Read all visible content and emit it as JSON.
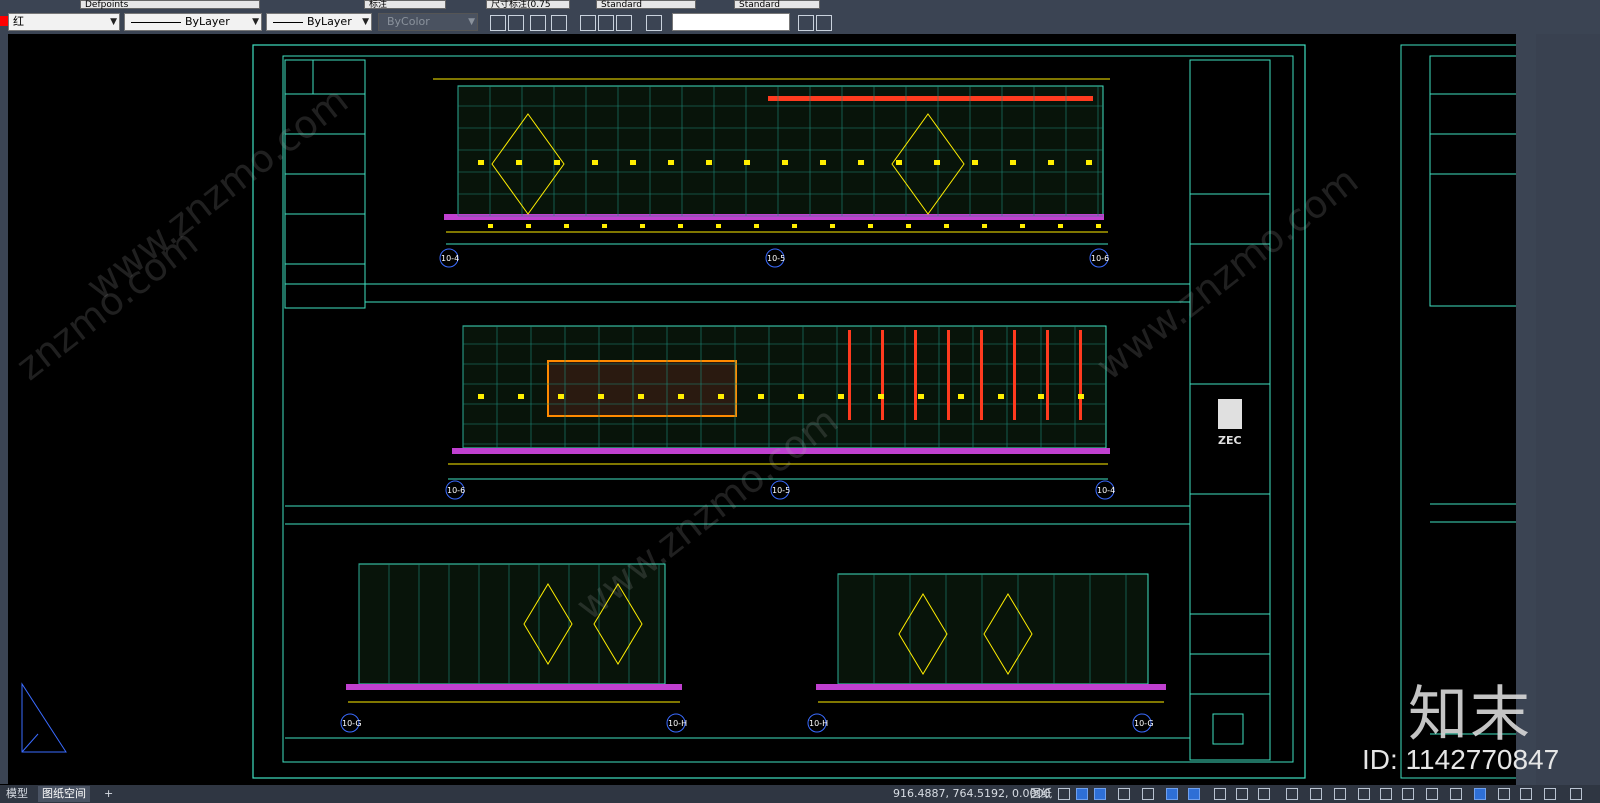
{
  "toolbar_top": {
    "linetype_value": "Defpoints",
    "layer_mini": "标注",
    "dimstyle_value": "尺寸标注(0.75",
    "textstyle_value": "Standard",
    "tablestyle_value": "Standard"
  },
  "toolbar_props": {
    "layer_value": "红",
    "linetype_value": "ByLayer",
    "lineweight_value": "ByLayer",
    "plotstyle_value": "ByColor",
    "search_value": ""
  },
  "colors": {
    "accent": "#00d8a8",
    "frame": "#3fe0c0",
    "yellow": "#ffee00",
    "red": "#ff3b1f",
    "magenta": "#c040d0",
    "blue_tag": "#3a6bff"
  },
  "drawing": {
    "grid_labels_top": [
      "10-4",
      "10-5",
      "10-6"
    ],
    "grid_labels_mid": [
      "10-6",
      "10-5",
      "10-4"
    ],
    "grid_labels_bl": [
      "10-G",
      "10-H"
    ],
    "grid_labels_br": [
      "10-H",
      "10-G"
    ],
    "title_block_logo": "ZEC"
  },
  "status": {
    "model_tab": "模型",
    "layout_tab": "图纸空间",
    "add_tab": "+",
    "coordinates": "916.4887, 764.5192, 0.0000",
    "paper_label": "图纸"
  },
  "watermark": {
    "brand": "知末",
    "asset_id": "ID: 1142770847"
  }
}
